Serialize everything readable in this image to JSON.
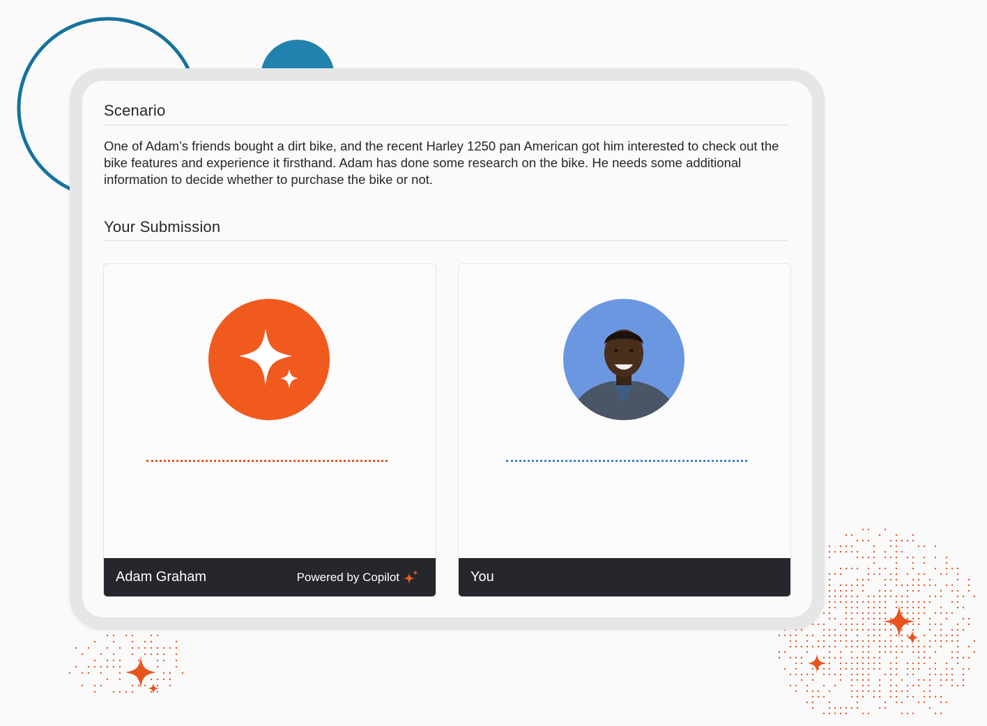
{
  "scenario": {
    "title": "Scenario",
    "body": "One of Adam’s friends bought a dirt bike, and the recent Harley 1250 pan American got him interested to check out the bike features and experience it firsthand. Adam has done some research on the bike. He needs some additional information to decide whether to purchase the bike or not."
  },
  "submission": {
    "title": "Your Submission",
    "participants": [
      {
        "name": "Adam Graham",
        "badge": "Powered by Copilot",
        "icon": "copilot-sparkle-icon",
        "accent": "#f05a1e",
        "line_color": "#e8541e"
      },
      {
        "name": "You",
        "icon": "user-avatar",
        "accent": "#6b97e0",
        "line_color": "#3c7fd1"
      }
    ]
  },
  "colors": {
    "brand_orange": "#f05a1e",
    "ring_blue": "#16729c",
    "footer_dark": "#25272d"
  }
}
